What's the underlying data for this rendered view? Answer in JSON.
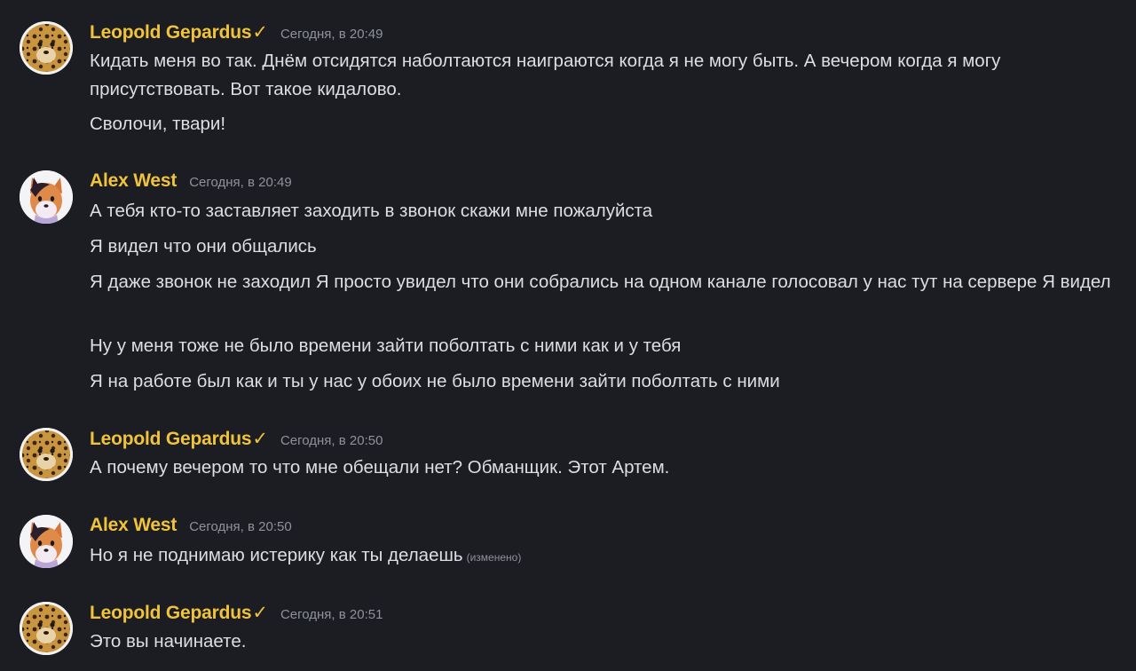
{
  "messages": {
    "g1": {
      "author": "Leopold Gepardus",
      "verified": "✓",
      "time": "Сегодня, в 20:49",
      "lines": [
        "Кидать меня во так. Днём отсидятся наболтаются наиграются когда я не могу быть. А вечером когда я могу присутствовать. Вот такое кидалово.",
        "Сволочи, твари!"
      ]
    },
    "g2": {
      "author": "Alex West",
      "time": "Сегодня, в 20:49",
      "lines": [
        "А тебя кто-то заставляет заходить в звонок скажи мне пожалуйста",
        "Я видел что они общались",
        "Я даже звонок не заходил Я просто увидел что они собрались на одном канале голосовал у нас тут на сервере Я видел",
        "Ну у меня тоже не было времени зайти поболтать с ними как и у тебя",
        "Я на работе был как и ты у нас у обоих не было времени зайти поболтать с ними"
      ]
    },
    "g3": {
      "author": "Leopold Gepardus",
      "verified": "✓",
      "time": "Сегодня, в 20:50",
      "lines": [
        "А почему вечером то что мне обещали нет? Обманщик. Этот Артем."
      ]
    },
    "g4": {
      "author": "Alex West",
      "time": "Сегодня, в 20:50",
      "lines": [
        "Но я не поднимаю истерику как ты делаешь"
      ],
      "edited": "(изменено)"
    },
    "g5": {
      "author": "Leopold Gepardus",
      "verified": "✓",
      "time": "Сегодня, в 20:51",
      "lines": [
        "Это вы начинаете."
      ]
    }
  },
  "avatars": {
    "leopold": "leopard-avatar",
    "alex": "fox-avatar"
  },
  "colors": {
    "background": "#1c1d22",
    "username": "#f0c33a",
    "text": "#dcdee3",
    "muted": "#8e929a"
  }
}
